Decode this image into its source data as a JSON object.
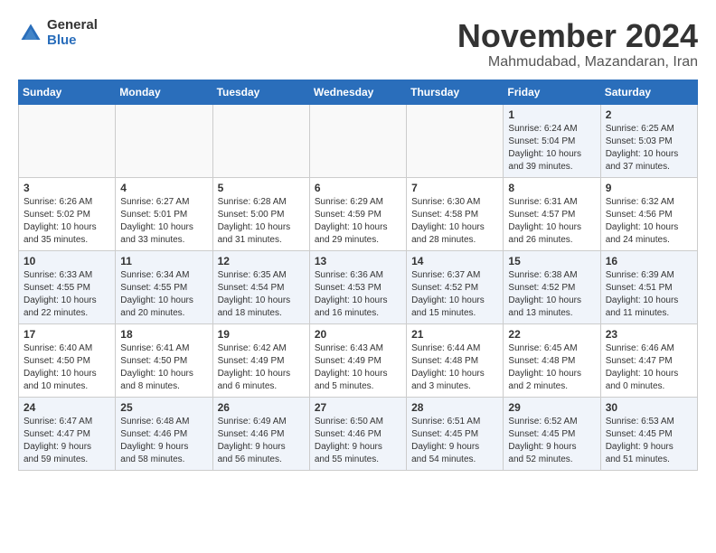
{
  "logo": {
    "general": "General",
    "blue": "Blue"
  },
  "title": "November 2024",
  "location": "Mahmudabad, Mazandaran, Iran",
  "days_of_week": [
    "Sunday",
    "Monday",
    "Tuesday",
    "Wednesday",
    "Thursday",
    "Friday",
    "Saturday"
  ],
  "weeks": [
    [
      {
        "day": "",
        "info": ""
      },
      {
        "day": "",
        "info": ""
      },
      {
        "day": "",
        "info": ""
      },
      {
        "day": "",
        "info": ""
      },
      {
        "day": "",
        "info": ""
      },
      {
        "day": "1",
        "info": "Sunrise: 6:24 AM\nSunset: 5:04 PM\nDaylight: 10 hours\nand 39 minutes."
      },
      {
        "day": "2",
        "info": "Sunrise: 6:25 AM\nSunset: 5:03 PM\nDaylight: 10 hours\nand 37 minutes."
      }
    ],
    [
      {
        "day": "3",
        "info": "Sunrise: 6:26 AM\nSunset: 5:02 PM\nDaylight: 10 hours\nand 35 minutes."
      },
      {
        "day": "4",
        "info": "Sunrise: 6:27 AM\nSunset: 5:01 PM\nDaylight: 10 hours\nand 33 minutes."
      },
      {
        "day": "5",
        "info": "Sunrise: 6:28 AM\nSunset: 5:00 PM\nDaylight: 10 hours\nand 31 minutes."
      },
      {
        "day": "6",
        "info": "Sunrise: 6:29 AM\nSunset: 4:59 PM\nDaylight: 10 hours\nand 29 minutes."
      },
      {
        "day": "7",
        "info": "Sunrise: 6:30 AM\nSunset: 4:58 PM\nDaylight: 10 hours\nand 28 minutes."
      },
      {
        "day": "8",
        "info": "Sunrise: 6:31 AM\nSunset: 4:57 PM\nDaylight: 10 hours\nand 26 minutes."
      },
      {
        "day": "9",
        "info": "Sunrise: 6:32 AM\nSunset: 4:56 PM\nDaylight: 10 hours\nand 24 minutes."
      }
    ],
    [
      {
        "day": "10",
        "info": "Sunrise: 6:33 AM\nSunset: 4:55 PM\nDaylight: 10 hours\nand 22 minutes."
      },
      {
        "day": "11",
        "info": "Sunrise: 6:34 AM\nSunset: 4:55 PM\nDaylight: 10 hours\nand 20 minutes."
      },
      {
        "day": "12",
        "info": "Sunrise: 6:35 AM\nSunset: 4:54 PM\nDaylight: 10 hours\nand 18 minutes."
      },
      {
        "day": "13",
        "info": "Sunrise: 6:36 AM\nSunset: 4:53 PM\nDaylight: 10 hours\nand 16 minutes."
      },
      {
        "day": "14",
        "info": "Sunrise: 6:37 AM\nSunset: 4:52 PM\nDaylight: 10 hours\nand 15 minutes."
      },
      {
        "day": "15",
        "info": "Sunrise: 6:38 AM\nSunset: 4:52 PM\nDaylight: 10 hours\nand 13 minutes."
      },
      {
        "day": "16",
        "info": "Sunrise: 6:39 AM\nSunset: 4:51 PM\nDaylight: 10 hours\nand 11 minutes."
      }
    ],
    [
      {
        "day": "17",
        "info": "Sunrise: 6:40 AM\nSunset: 4:50 PM\nDaylight: 10 hours\nand 10 minutes."
      },
      {
        "day": "18",
        "info": "Sunrise: 6:41 AM\nSunset: 4:50 PM\nDaylight: 10 hours\nand 8 minutes."
      },
      {
        "day": "19",
        "info": "Sunrise: 6:42 AM\nSunset: 4:49 PM\nDaylight: 10 hours\nand 6 minutes."
      },
      {
        "day": "20",
        "info": "Sunrise: 6:43 AM\nSunset: 4:49 PM\nDaylight: 10 hours\nand 5 minutes."
      },
      {
        "day": "21",
        "info": "Sunrise: 6:44 AM\nSunset: 4:48 PM\nDaylight: 10 hours\nand 3 minutes."
      },
      {
        "day": "22",
        "info": "Sunrise: 6:45 AM\nSunset: 4:48 PM\nDaylight: 10 hours\nand 2 minutes."
      },
      {
        "day": "23",
        "info": "Sunrise: 6:46 AM\nSunset: 4:47 PM\nDaylight: 10 hours\nand 0 minutes."
      }
    ],
    [
      {
        "day": "24",
        "info": "Sunrise: 6:47 AM\nSunset: 4:47 PM\nDaylight: 9 hours\nand 59 minutes."
      },
      {
        "day": "25",
        "info": "Sunrise: 6:48 AM\nSunset: 4:46 PM\nDaylight: 9 hours\nand 58 minutes."
      },
      {
        "day": "26",
        "info": "Sunrise: 6:49 AM\nSunset: 4:46 PM\nDaylight: 9 hours\nand 56 minutes."
      },
      {
        "day": "27",
        "info": "Sunrise: 6:50 AM\nSunset: 4:46 PM\nDaylight: 9 hours\nand 55 minutes."
      },
      {
        "day": "28",
        "info": "Sunrise: 6:51 AM\nSunset: 4:45 PM\nDaylight: 9 hours\nand 54 minutes."
      },
      {
        "day": "29",
        "info": "Sunrise: 6:52 AM\nSunset: 4:45 PM\nDaylight: 9 hours\nand 52 minutes."
      },
      {
        "day": "30",
        "info": "Sunrise: 6:53 AM\nSunset: 4:45 PM\nDaylight: 9 hours\nand 51 minutes."
      }
    ]
  ]
}
